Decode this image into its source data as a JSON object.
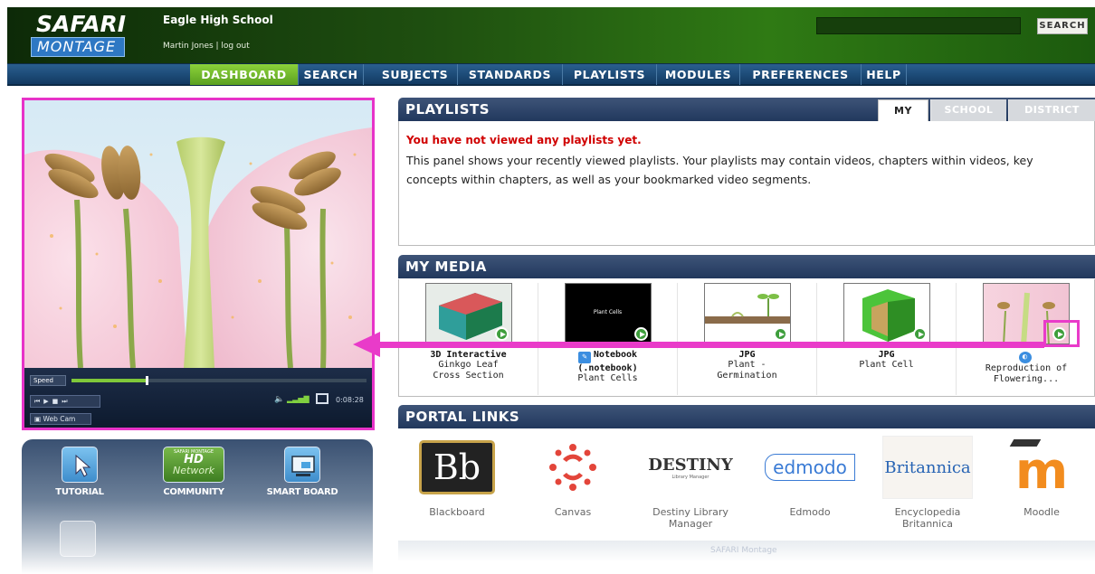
{
  "header": {
    "logo_top": "SAFARI",
    "logo_bottom": "MONTAGE",
    "school": "Eagle High School",
    "user_line": "Martin Jones | log out",
    "search_button": "SEARCH"
  },
  "nav": {
    "items": [
      "DASHBOARD",
      "SEARCH",
      "SUBJECTS",
      "STANDARDS",
      "PLAYLISTS",
      "MODULES",
      "PREFERENCES",
      "HELP"
    ],
    "active": "DASHBOARD"
  },
  "player": {
    "speed_label": "Speed",
    "progress": 0.25,
    "time": "0:08:28",
    "webcam_label": "Web Cam"
  },
  "tools": {
    "items": [
      {
        "label": "TUTORIAL",
        "icon": "cursor-icon"
      },
      {
        "label": "COMMUNITY",
        "icon": "hd-network-icon",
        "icon_text_top": "SAFARI MONTAGE",
        "icon_text_mid": "HD",
        "icon_text_bottom": "Network"
      },
      {
        "label": "SMART BOARD",
        "icon": "smart-board-icon"
      }
    ]
  },
  "playlists": {
    "title": "PLAYLISTS",
    "tabs": [
      "MY",
      "SCHOOL",
      "DISTRICT"
    ],
    "active_tab": "MY",
    "empty_message": "You have not viewed any playlists yet.",
    "description": "This panel shows your recently viewed playlists. Your playlists may contain videos, chapters within videos, key concepts within chapters, as well as your bookmarked video segments."
  },
  "my_media": {
    "title": "MY MEDIA",
    "items": [
      {
        "type": "3D Interactive",
        "name": "Ginkgo Leaf Cross Section",
        "line1": "Ginkgo Leaf",
        "line2": "Cross Section"
      },
      {
        "type": "Notebook (.notebook)",
        "type_line1": "Notebook",
        "type_line2": "(.notebook)",
        "name": "Plant Cells",
        "thumb_text": "Plant Cells"
      },
      {
        "type": "JPG",
        "name": "Plant - Germination",
        "line1": "Plant -",
        "line2": "Germination"
      },
      {
        "type": "JPG",
        "name": "Plant Cell"
      },
      {
        "type": "",
        "name": "Reproduction of Flowering...",
        "line1": "Reproduction of",
        "line2": "Flowering..."
      }
    ]
  },
  "portal_links": {
    "title": "PORTAL LINKS",
    "items": [
      {
        "name": "Blackboard",
        "logo_text": "Bb"
      },
      {
        "name": "Canvas"
      },
      {
        "name": "Destiny Library Manager",
        "line1": "Destiny Library",
        "line2": "Manager",
        "logo_text": "DESTINY",
        "logo_sub": "Library Manager"
      },
      {
        "name": "Edmodo",
        "logo_text": "edmodo"
      },
      {
        "name": "Encyclopedia Britannica",
        "line1": "Encyclopedia",
        "line2": "Britannica",
        "logo_text": "Britannica"
      },
      {
        "name": "Moodle",
        "logo_text": "m"
      }
    ]
  },
  "footer_text": "SAFARI Montage",
  "colors": {
    "accent_magenta": "#e93bc9",
    "nav_active": "#6fb82c",
    "panel_header": "#2b4268",
    "error_red": "#d00000"
  }
}
